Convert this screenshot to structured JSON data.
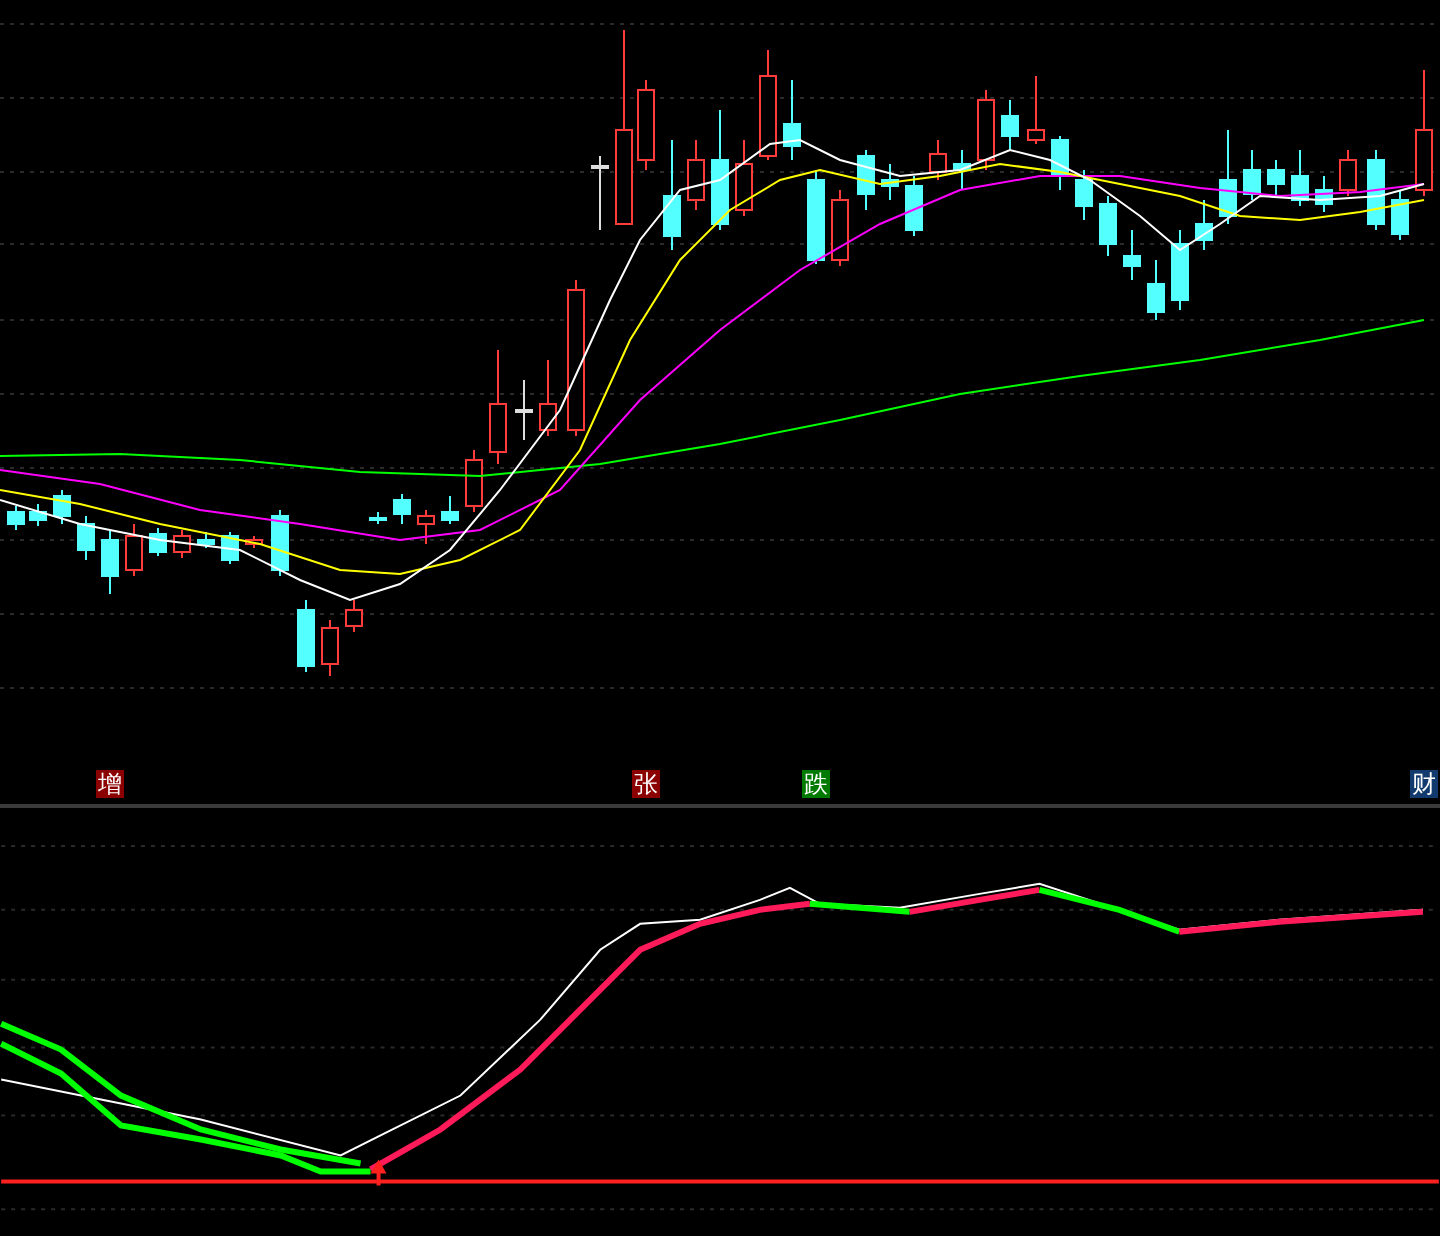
{
  "signal_markers": [
    {
      "label": "增",
      "color": "#8b0000"
    },
    {
      "label": "张",
      "color": "#8b0000"
    },
    {
      "label": "跌",
      "color": "#007a00"
    },
    {
      "label": "财",
      "color": "#123a6e"
    }
  ]
}
